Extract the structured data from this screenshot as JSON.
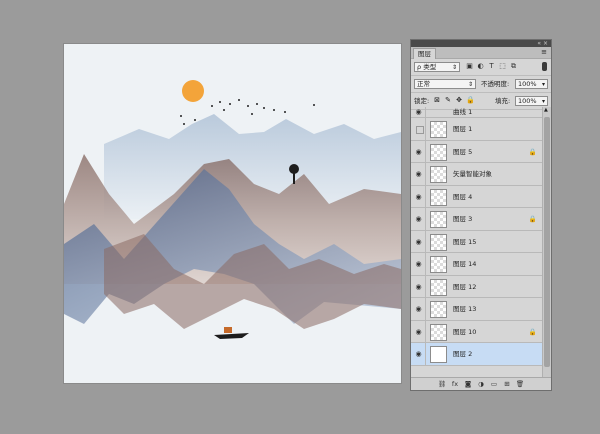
{
  "canvas": {
    "scene": "ink-style landscape with sun, birds, tree and boat"
  },
  "panel": {
    "tab_label": "图层",
    "collapse_icon": "«",
    "close_icon": "×",
    "menu_icon": "≡",
    "filter": {
      "label": "ρ 类型",
      "icons": [
        "image-filter-icon",
        "adjustment-filter-icon",
        "type-filter-icon",
        "shape-filter-icon",
        "smart-object-filter-icon"
      ],
      "glyphs": [
        "▣",
        "◐",
        "T",
        "⬚",
        "⧉"
      ]
    },
    "blend_mode": "正常",
    "opacity_label": "不透明度:",
    "opacity_value": "100%",
    "lock_label": "锁定:",
    "lock_glyphs": [
      "⊠",
      "✎",
      "✥",
      "🔒"
    ],
    "fill_label": "填充:",
    "fill_value": "100%",
    "layers": [
      {
        "name": "曲线 1",
        "visible": true,
        "locked": false,
        "kind": "adjustment"
      },
      {
        "name": "图层 1",
        "visible": false,
        "locked": false,
        "kind": "pixel"
      },
      {
        "name": "图层 5",
        "visible": true,
        "locked": true,
        "kind": "pixel"
      },
      {
        "name": "矢量智能对象",
        "visible": true,
        "locked": false,
        "kind": "pixel"
      },
      {
        "name": "图层 4",
        "visible": true,
        "locked": false,
        "kind": "pixel"
      },
      {
        "name": "图层 3",
        "visible": true,
        "locked": true,
        "kind": "pixel"
      },
      {
        "name": "图层 15",
        "visible": true,
        "locked": false,
        "kind": "pixel"
      },
      {
        "name": "图层 14",
        "visible": true,
        "locked": false,
        "kind": "pixel"
      },
      {
        "name": "图层 12",
        "visible": true,
        "locked": false,
        "kind": "pixel"
      },
      {
        "name": "图层 13",
        "visible": true,
        "locked": false,
        "kind": "pixel"
      },
      {
        "name": "图层 10",
        "visible": true,
        "locked": true,
        "kind": "pixel"
      },
      {
        "name": "图层 2",
        "visible": true,
        "locked": false,
        "kind": "white",
        "selected": true
      }
    ],
    "footer": {
      "icons": [
        "link-icon",
        "fx-icon",
        "mask-icon",
        "adjustment-icon",
        "group-icon",
        "new-layer-icon",
        "delete-icon"
      ],
      "glyphs": [
        "⛓",
        "fx",
        "◙",
        "◑",
        "▭",
        "⊞",
        "🗑"
      ]
    },
    "colors": {
      "selected": "#c7dcf4",
      "panel_bg": "#d6d6d6",
      "sun": "#f3a43a"
    }
  }
}
